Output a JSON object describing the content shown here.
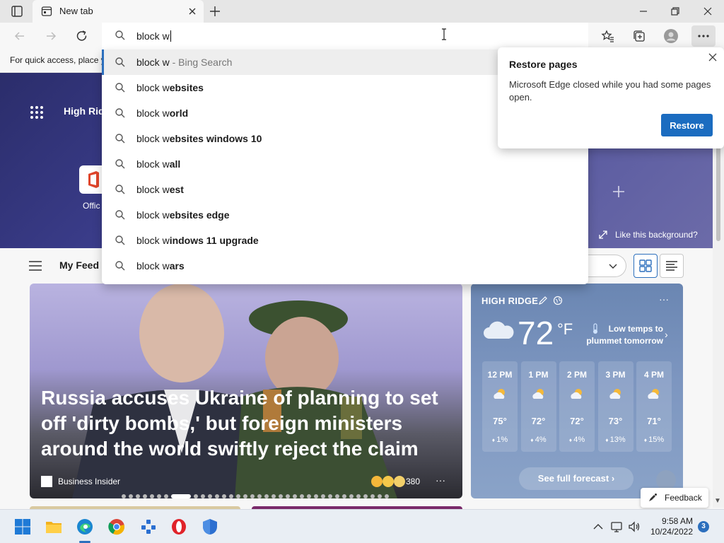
{
  "browser": {
    "tab_title": "New tab",
    "address_text": "block w",
    "favorites_hint": "For quick access, place y"
  },
  "suggestions": [
    {
      "typed": "block w",
      "completion": "",
      "hint": " - Bing Search"
    },
    {
      "typed": "block w",
      "completion": "ebsites",
      "hint": ""
    },
    {
      "typed": "block w",
      "completion": "orld",
      "hint": ""
    },
    {
      "typed": "block w",
      "completion": "ebsites windows 10",
      "hint": ""
    },
    {
      "typed": "block w",
      "completion": "all",
      "hint": ""
    },
    {
      "typed": "block w",
      "completion": "est",
      "hint": ""
    },
    {
      "typed": "block w",
      "completion": "ebsites edge",
      "hint": ""
    },
    {
      "typed": "block w",
      "completion": "indows 11 upgrade",
      "hint": ""
    },
    {
      "typed": "block w",
      "completion": "ars",
      "hint": ""
    }
  ],
  "restore": {
    "title": "Restore pages",
    "message": "Microsoft Edge closed while you had some pages open.",
    "button": "Restore"
  },
  "newtab": {
    "location_text": "High Rid",
    "office_label": "Offic",
    "like_background": "Like this background?",
    "feed_label": "My Feed"
  },
  "news": {
    "headline": "Russia accuses Ukraine of planning to set off 'dirty bombs,' but foreign ministers around the world swiftly reject the claim",
    "source": "Business Insider",
    "reaction_count": "380",
    "more": "···",
    "dot_count": 36,
    "active_dot": 7
  },
  "weather": {
    "location": "HIGH RIDGE",
    "temperature": "72",
    "unit": "°F",
    "alert": "Low temps to plummet tomorrow",
    "more": "···",
    "hourly": [
      {
        "time": "12 PM",
        "temp": "75°",
        "precip": "1%"
      },
      {
        "time": "1 PM",
        "temp": "72°",
        "precip": "4%"
      },
      {
        "time": "2 PM",
        "temp": "72°",
        "precip": "4%"
      },
      {
        "time": "3 PM",
        "temp": "73°",
        "precip": "13%"
      },
      {
        "time": "4 PM",
        "temp": "71°",
        "precip": "15%"
      }
    ],
    "forecast_button": "See full forecast"
  },
  "feedback": {
    "label": "Feedback"
  },
  "taskbar": {
    "time": "9:58 AM",
    "date": "10/24/2022",
    "notification_count": "3"
  },
  "colors": {
    "accent": "#2c6fbd",
    "restore_button": "#1b6cc0",
    "hero": "#3d3f8f",
    "weather_card": "#7d96c0"
  }
}
